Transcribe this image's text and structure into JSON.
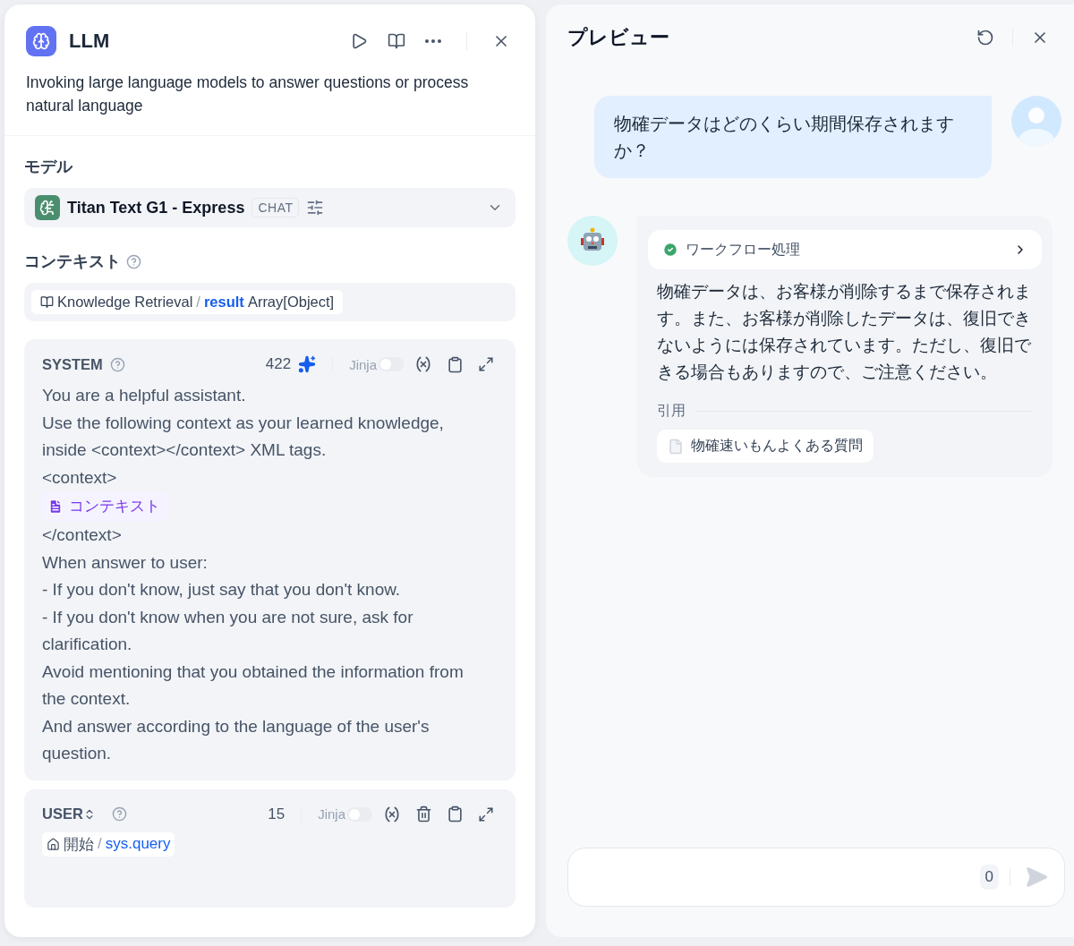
{
  "node_panel": {
    "title": "LLM",
    "description": "Invoking large language models to answer questions or process natural language",
    "model": {
      "label": "モデル",
      "name": "Titan Text G1 - Express",
      "mode": "CHAT"
    },
    "context": {
      "label": "コンテキスト",
      "source": "Knowledge Retrieval",
      "separator": "/",
      "variable": "result",
      "type": "Array[Object]"
    },
    "prompts": [
      {
        "role": "SYSTEM",
        "role_switch": false,
        "count": "422",
        "generate": true,
        "deletable": false,
        "jinja": {
          "label": "Jinja",
          "on": false
        },
        "lines": [
          {
            "kind": "text",
            "text": "You are a helpful assistant."
          },
          {
            "kind": "text",
            "text": "Use the following context as your learned knowledge, inside <context></context> XML tags."
          },
          {
            "kind": "text",
            "text": "<context>"
          },
          {
            "kind": "context",
            "text": "コンテキスト"
          },
          {
            "kind": "text",
            "text": "</context>"
          },
          {
            "kind": "text",
            "text": "When answer to user:"
          },
          {
            "kind": "text",
            "text": "- If you don't know, just say that you don't know."
          },
          {
            "kind": "text",
            "text": "- If you don't know when you are not sure, ask for clarification."
          },
          {
            "kind": "text",
            "text": "Avoid mentioning that you obtained the information from the context."
          },
          {
            "kind": "text",
            "text": "And answer according to the language of the user's question."
          }
        ]
      },
      {
        "role": "USER",
        "role_switch": true,
        "count": "15",
        "generate": false,
        "deletable": true,
        "jinja": {
          "label": "Jinja",
          "on": false
        },
        "lines": [
          {
            "kind": "variable",
            "node": "開始",
            "separator": "/",
            "text": "sys.query"
          }
        ]
      }
    ]
  },
  "preview": {
    "title": "プレビュー",
    "messages": [
      {
        "kind": "user",
        "text": "物確データはどのくらい期間保存されますか？"
      },
      {
        "kind": "bot",
        "workflow": {
          "label": "ワークフロー処理",
          "completed": true
        },
        "text": "物確データは、お客様が削除するまで保存されます。また、お客様が削除したデータは、復旧できないようには保存されています。ただし、復旧できる場合もありますので、ご注意ください。",
        "citation_label": "引用",
        "citations": [
          "物確速いもんよくある質問"
        ]
      }
    ],
    "input": {
      "count": "0"
    }
  }
}
